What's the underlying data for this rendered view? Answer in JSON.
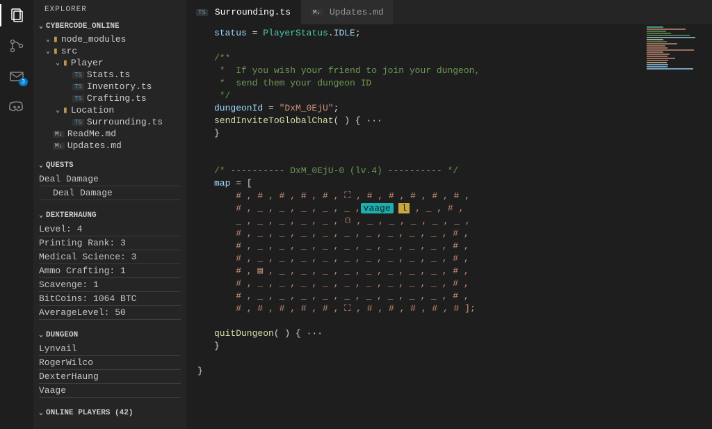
{
  "activity": {
    "mail_badge": "3"
  },
  "sidebar": {
    "title": "EXPLORER",
    "sections": {
      "project": "CYBERCODE_ONLINE",
      "quests": "QUESTS",
      "player": "DEXTERHAUNG",
      "dungeon": "DUNGEON",
      "online": "ONLINE PLAYERS (42)"
    },
    "tree": {
      "node_modules": "node_modules",
      "src": "src",
      "player_folder": "Player",
      "stats": "Stats.ts",
      "inventory": "Inventory.ts",
      "crafting": "Crafting.ts",
      "location_folder": "Location",
      "surrounding": "Surrounding.ts",
      "readme": "ReadMe.md",
      "updates": "Updates.md"
    },
    "quests": {
      "main": "Deal Damage",
      "sub": "Deal Damage"
    },
    "stats": {
      "level": "Level: 4",
      "printing": "Printing Rank: 3",
      "medical": "Medical Science: 3",
      "ammo": "Ammo Crafting: 1",
      "scavenge": "Scavenge: 1",
      "bitcoins": "BitCoins: 1064 BTC",
      "avg": "AverageLevel: 50"
    },
    "party": [
      "Lynvail",
      "RogerWilco",
      "DexterHaung",
      "Vaage"
    ]
  },
  "tabs": {
    "t1": "Surrounding.ts",
    "t2": "Updates.md"
  },
  "code": {
    "status_lhs": "status",
    "status_eq": " = ",
    "status_type": "PlayerStatus",
    "status_dot": ".",
    "status_val": "IDLE",
    "semicolon": ";",
    "comment_open": "/**",
    "comment_l1": " *  If you wish your friend to join your dungeon,",
    "comment_l2": " *  send them your dungeon ID",
    "comment_close": " */",
    "dungeon_lhs": "dungeonId",
    "dungeon_val": "\"DxM_0EjU\"",
    "send_fn": "sendInviteToGlobalChat",
    "send_suffix": "( ) { ···",
    "brace_close": "}",
    "map_comment": "/* ---------- DxM_0EjU-0 (lv.4) ---------- */",
    "map_lhs": "map",
    "map_open": " = [",
    "rows": [
      "    # , # , # , # , # , ⛶ , # , # , # , # , # ,",
      "    # , _ , _ , _ , _ , _ ,",
      "    _ , _ , _ , _ , _ , ⛻ , _ , _ , _ , _ , _ ,",
      "    # , _ , _ , _ , _ , _ , _ , _ , _ , _ , # ,",
      "    # , _ , _ , _ , _ , _ , _ , _ , _ , _ , # ,",
      "    # , _ , _ , _ , _ , _ , _ , _ , _ , _ , # ,",
      "    # , ▤ , _ , _ , _ , _ , _ , _ , _ , _ , # ,",
      "    # , _ , _ , _ , _ , _ , _ , _ , _ , _ , # ,",
      "    # , _ , _ , _ , _ , _ , _ , _ , _ , _ , # ,",
      "    # , # , # , # , # , ⛶ , # , # , # , # , # ];"
    ],
    "row1_tail": " , _ , # ,",
    "player_tag": "vaage",
    "player_cursor": "l",
    "quit_fn": "quitDungeon",
    "quit_suffix": "( ) { ···"
  },
  "minimap_colors": [
    "#4ec9b0",
    "#ce9178",
    "#6a9955",
    "#6a9955",
    "#6a9955",
    "#9cdcfe",
    "#dcdcaa",
    "#6a9955",
    "#ce9178",
    "#ce9178",
    "#ce9178",
    "#ce9178",
    "#ce9178",
    "#ce9178",
    "#ce9178",
    "#ce9178",
    "#ce9178",
    "#dcdcaa",
    "#9cdcfe",
    "#9cdcfe",
    "#9cdcfe"
  ]
}
